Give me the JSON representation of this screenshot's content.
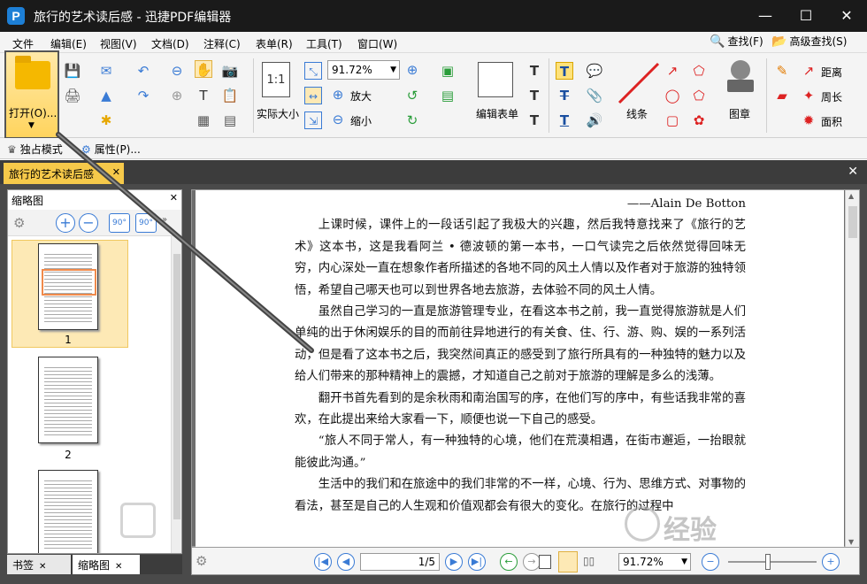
{
  "window": {
    "title": "旅行的艺术读后感 - 迅捷PDF编辑器",
    "app_icon": "P",
    "minimize": "—",
    "maximize": "☐",
    "close": "✕"
  },
  "menu": {
    "items": [
      "文件",
      "编辑(E)",
      "视图(V)",
      "文档(D)",
      "注释(C)",
      "表单(R)",
      "工具(T)",
      "窗口(W)"
    ],
    "find": "查找(F)",
    "advanced_find": "高级查找(S)"
  },
  "ribbon": {
    "open": "打开(O)...",
    "actual_size": "实际大小",
    "fit_icon": "1:1",
    "zoom": "91.72%",
    "zoom_in": "放大",
    "zoom_out": "缩小",
    "edit_form": "编辑表单",
    "line": "线条",
    "stamp": "图章",
    "distance": "距离",
    "perimeter": "周长",
    "area": "面积"
  },
  "subbar": {
    "exclusive_mode": "独占模式",
    "properties": "属性(P)..."
  },
  "tabs": {
    "document": "旅行的艺术读后感"
  },
  "thumbnails": {
    "title": "缩略图",
    "pages": [
      "1",
      "2"
    ],
    "rotate_left": "90°",
    "rotate_right": "90°"
  },
  "bottom_tabs": {
    "bookmarks": "书签",
    "thumbnails": "缩略图"
  },
  "document": {
    "author": "——Alain De Botton",
    "paragraphs": [
      "上课时候，课件上的一段话引起了我极大的兴趣，然后我特意找来了《旅行的艺术》这本书，这是我看阿兰 • 德波顿的第一本书，一口气读完之后依然觉得回味无穷，内心深处一直在想象作者所描述的各地不同的风土人情以及作者对于旅游的独特领悟，希望自己哪天也可以到世界各地去旅游，去体验不同的风土人情。",
      "虽然自己学习的一直是旅游管理专业，在看这本书之前，我一直觉得旅游就是人们单纯的出于休闲娱乐的目的而前往异地进行的有关食、住、行、游、购、娱的一系列活动，但是看了这本书之后，我突然间真正的感受到了旅行所具有的一种独特的魅力以及给人们带来的那种精神上的震撼，才知道自己之前对于旅游的理解是多么的浅薄。",
      "翻开书首先看到的是余秋雨和南治国写的序，在他们写的序中，有些话我非常的喜欢，在此提出来给大家看一下，顺便也说一下自己的感受。",
      "“旅人不同于常人，有一种独特的心境，他们在荒漠相遇，在街市邂逅，一抬眼就能彼此沟通。”",
      "生活中的我们和在旅途中的我们非常的不一样，心境、行为、思维方式、对事物的看法，甚至是自己的人生观和价值观都会有很大的变化。在旅行的过程中"
    ]
  },
  "status": {
    "page": "1/5",
    "zoom": "91.72%",
    "first": "|◀",
    "prev": "◀",
    "next": "▶",
    "last": "▶|"
  },
  "watermark": {
    "text": "经验"
  },
  "colors": {
    "accent": "#3a7bd5",
    "tab_active": "#f6c94a",
    "title_bar": "#1a1a1a",
    "callout": "#444444"
  }
}
